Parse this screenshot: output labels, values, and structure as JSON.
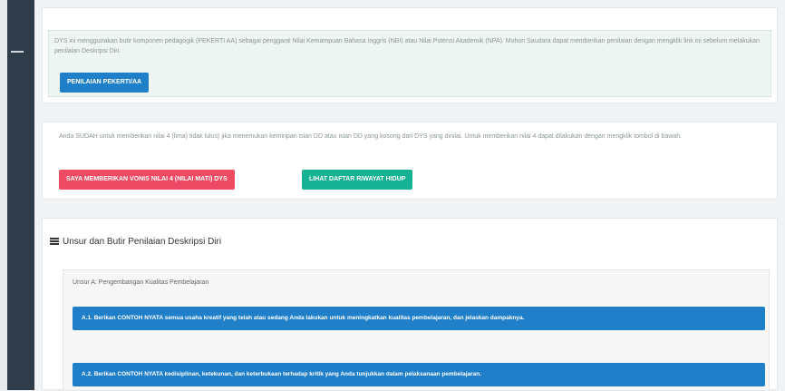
{
  "card_intro": {
    "text": "DYS ini menggunakan butir komponen pedagogik (PEKERTI AA) sebagai pengganti Nilai Kemampuan Bahasa Inggris (NBI) atau Nilai Potensi Akademik (NPA). Mohon Saudara dapat memberikan penilaian dengan mengklik link ini sebelum melakukan penilaian Deskripsi Diri.",
    "button_label": "PENILAIAN PEKERTI/AA"
  },
  "card_resume": {
    "text": "Anda SUDAH untuk memberikan nilai 4 (lima) tidak lulus) jika menemukan kemiripan isian DD atau isian DD yang kosong dari DYS yang dinilai. Untuk memberikan nilai 4 dapat dilakukan dengan mengklik tombol di bawah.",
    "red_button_label": "SAYA MEMBERIKAN VONIS NILAI 4 (NILAI MATI) DYS",
    "green_button_label": "LIHAT DAFTAR RIWAYAT HIDUP"
  },
  "card_items": {
    "title": "Unsur dan Butir Penilaian Deskripsi Diri",
    "sub_title": "Unsur A: Pengembangan Kualitas Pembelajaran",
    "questions": [
      "A.1. Berikan CONTOH NYATA semua usaha kreatif yang telah atau sedang Anda lakukan untuk meningkatkan kualitas pembelajaran, dan jelaskan dampaknya.",
      "A.2. Berikan CONTOH NYATA kedisiplinan, ketekunan, dan keterbukaan terhadap kritik yang Anda tunjukkan dalam pelaksanaan pembelajaran."
    ]
  },
  "colors": {
    "sidebar": "#2f3d4a",
    "primary": "#1f7fc8",
    "danger": "#ef4a63",
    "success": "#16b294"
  }
}
